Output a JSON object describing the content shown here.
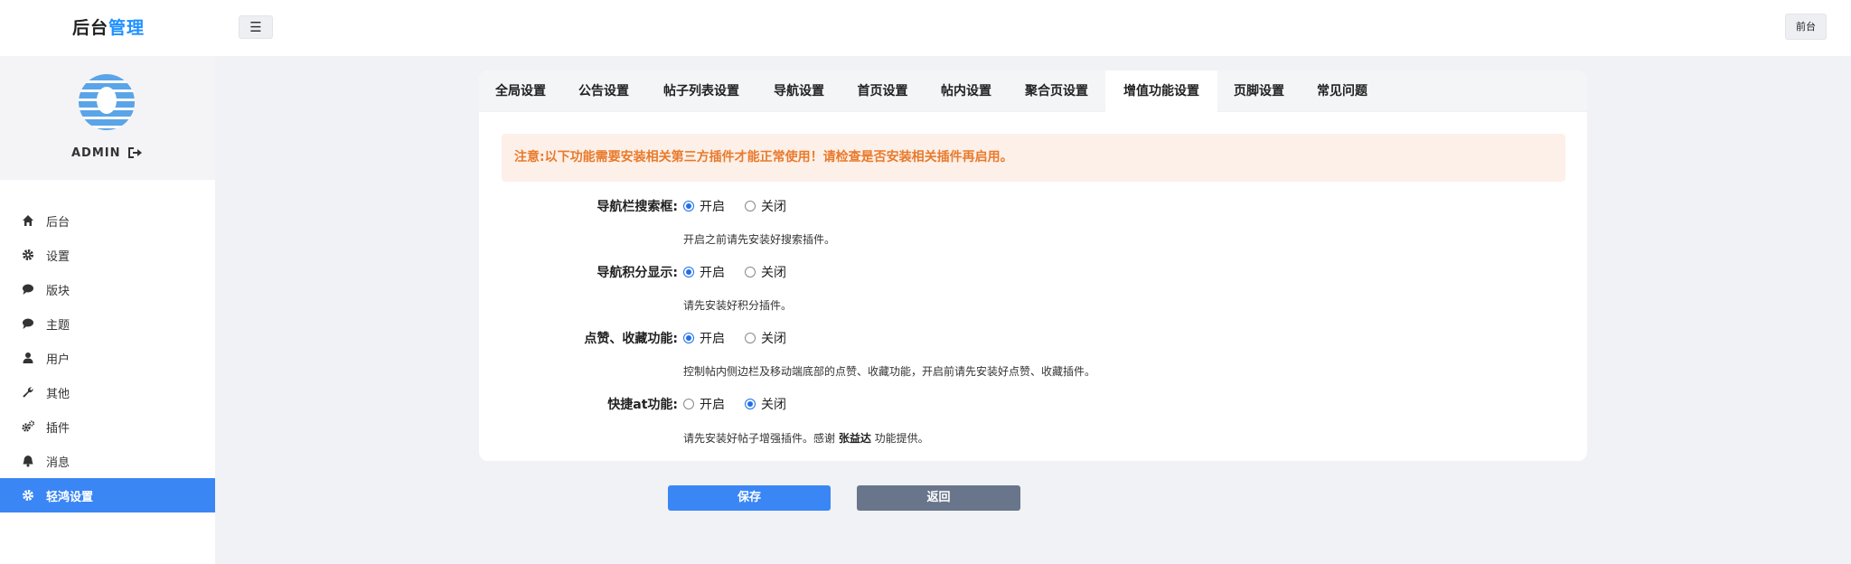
{
  "header": {
    "logo_part1": "后台",
    "logo_part2": "管理",
    "menu_toggle_glyph": "☰",
    "front_button": "前台",
    "accent_color": "#1e90ff"
  },
  "sidebar": {
    "admin_name": "ADMIN",
    "items": [
      {
        "label": "后台",
        "icon": "home-icon",
        "active": false
      },
      {
        "label": "设置",
        "icon": "gear-icon",
        "active": false
      },
      {
        "label": "版块",
        "icon": "comment-icon",
        "active": false
      },
      {
        "label": "主题",
        "icon": "comment-icon",
        "active": false
      },
      {
        "label": "用户",
        "icon": "user-icon",
        "active": false
      },
      {
        "label": "其他",
        "icon": "wrench-icon",
        "active": false
      },
      {
        "label": "插件",
        "icon": "gears-icon",
        "active": false
      },
      {
        "label": "消息",
        "icon": "bell-icon",
        "active": false
      },
      {
        "label": "轻鸿设置",
        "icon": "gear-icon",
        "active": true
      }
    ],
    "active_color": "#3a86f5"
  },
  "tabs": [
    {
      "label": "全局设置",
      "active": false
    },
    {
      "label": "公告设置",
      "active": false
    },
    {
      "label": "帖子列表设置",
      "active": false
    },
    {
      "label": "导航设置",
      "active": false
    },
    {
      "label": "首页设置",
      "active": false
    },
    {
      "label": "帖内设置",
      "active": false
    },
    {
      "label": "聚合页设置",
      "active": false
    },
    {
      "label": "增值功能设置",
      "active": true
    },
    {
      "label": "页脚设置",
      "active": false
    },
    {
      "label": "常见问题",
      "active": false
    }
  ],
  "notice": "注意:以下功能需要安装相关第三方插件才能正常使用！请检查是否安装相关插件再启用。",
  "settings": [
    {
      "label": "导航栏搜索框:",
      "on_label": "开启",
      "off_label": "关闭",
      "value": "on",
      "help": "开启之前请先安装好搜索插件。"
    },
    {
      "label": "导航积分显示:",
      "on_label": "开启",
      "off_label": "关闭",
      "value": "on",
      "help": "请先安装好积分插件。"
    },
    {
      "label": "点赞、收藏功能:",
      "on_label": "开启",
      "off_label": "关闭",
      "value": "on",
      "help": "控制帖内侧边栏及移动端底部的点赞、收藏功能，开启前请先安装好点赞、收藏插件。"
    },
    {
      "label": "快捷at功能:",
      "on_label": "开启",
      "off_label": "关闭",
      "value": "off",
      "help_prefix": "请先安装好帖子增强插件。感谢 ",
      "help_name": "张益达",
      "help_suffix": " 功能提供。"
    }
  ],
  "buttons": {
    "save": "保存",
    "back": "返回"
  }
}
